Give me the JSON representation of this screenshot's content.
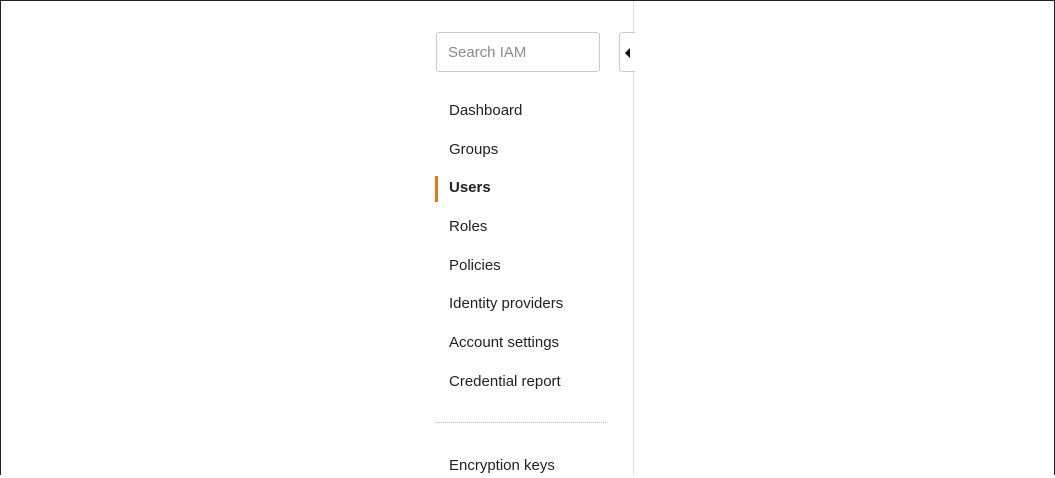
{
  "search": {
    "placeholder": "Search IAM"
  },
  "sidebar": {
    "items": [
      {
        "label": "Dashboard"
      },
      {
        "label": "Groups"
      },
      {
        "label": "Users",
        "active": true
      },
      {
        "label": "Roles"
      },
      {
        "label": "Policies"
      },
      {
        "label": "Identity providers"
      },
      {
        "label": "Account settings"
      },
      {
        "label": "Credential report"
      }
    ],
    "secondary_items": [
      {
        "label": "Encryption keys"
      }
    ]
  },
  "colors": {
    "active_accent": "#e07b16",
    "text": "#222222",
    "border": "#c9c9c9"
  },
  "icons": {
    "collapse_toggle": "caret-left-icon"
  }
}
